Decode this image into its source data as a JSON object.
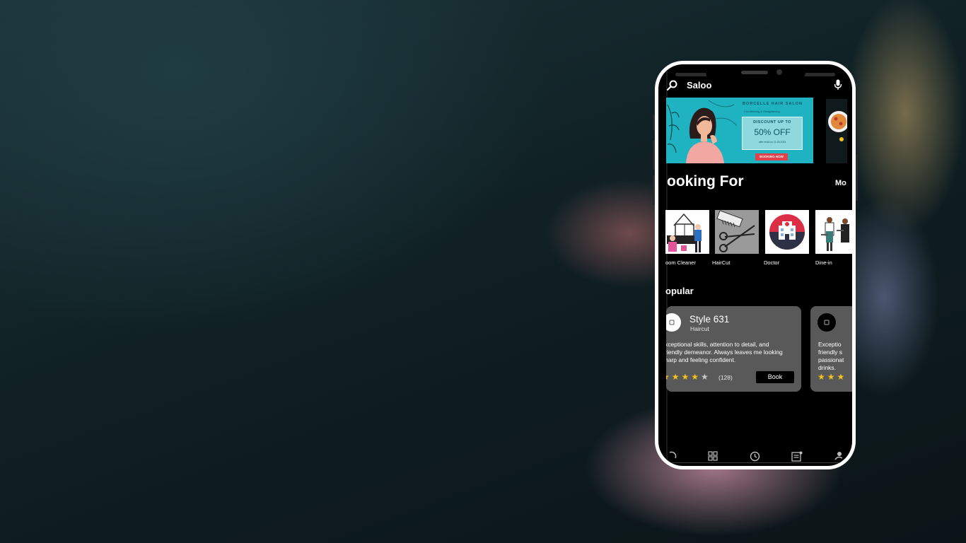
{
  "search": {
    "text": "Saloo"
  },
  "banner": {
    "title": "BORCELLE HAIR SALON",
    "subtitle": "Conditioning & Straightening",
    "discount_label": "DISCOUNT UP TO",
    "discount_value": "50% OFF",
    "note": "offer ends on 11.09.2023",
    "cta": "BOOKING NOW",
    "accent": "#1fb3c2"
  },
  "looking_for": {
    "title": "ooking For",
    "more_label": "Mo",
    "categories": [
      {
        "label": "oom Cleaner",
        "icon": "room-cleaner-illustration"
      },
      {
        "label": "HairCut",
        "icon": "haircut-tools-illustration"
      },
      {
        "label": "Doctor",
        "icon": "hospital-icon"
      },
      {
        "label": "Dine-in",
        "icon": "chefs-illustration"
      }
    ]
  },
  "popular": {
    "title": "opular",
    "cards": [
      {
        "name": "Style 631",
        "type": "Haircut",
        "desc_lines": [
          "xceptional skills, attention to detail, and",
          "riendly demeanor. Always leaves me looking",
          "harp and feeling confident."
        ],
        "stars_on": "★★★★",
        "stars_off": "★",
        "rating_count": "(128)",
        "book_label": "Book"
      },
      {
        "desc_lines": [
          "Exceptio",
          "friendly s",
          "passionat",
          "drinks."
        ],
        "stars_on": "★★★"
      }
    ]
  },
  "bottom_nav": [
    "home-icon",
    "grid-icon",
    "clock-icon",
    "orders-icon",
    "profile-icon"
  ],
  "colors": {
    "star": "#f4c21b",
    "card": "#595959",
    "cta_red": "#e2404a"
  }
}
